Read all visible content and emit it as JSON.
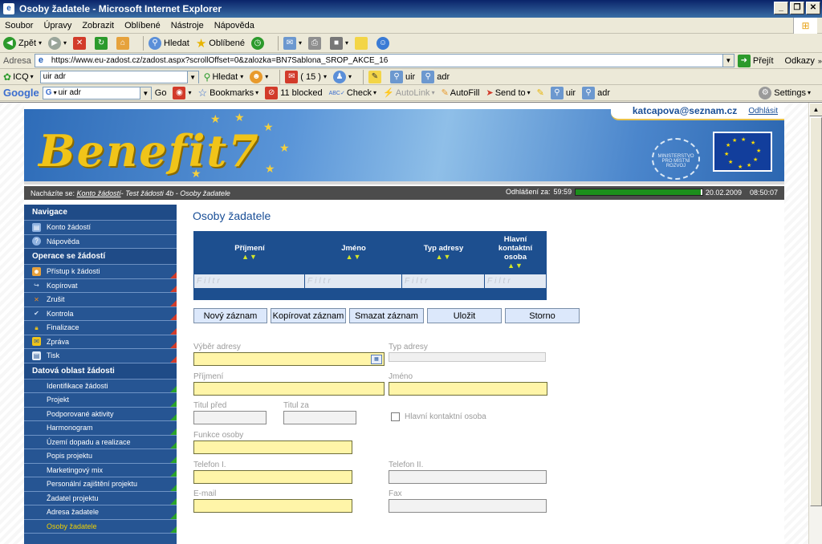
{
  "window": {
    "title": "Osoby žadatele - Microsoft Internet Explorer"
  },
  "menu": [
    "Soubor",
    "Úpravy",
    "Zobrazit",
    "Oblíbené",
    "Nástroje",
    "Nápověda"
  ],
  "toolbar": {
    "back": "Zpět",
    "search": "Hledat",
    "favorites": "Oblíbené"
  },
  "address": {
    "label": "Adresa",
    "url": "https://www.eu-zadost.cz/zadost.aspx?scrollOffset=0&zalozka=BN7Sablona_SROP_AKCE_16",
    "go": "Přejít",
    "links": "Odkazy"
  },
  "icqbar": {
    "icq": "ICQ",
    "query": "uir adr",
    "search": "Hledat",
    "count": "( 15 )",
    "uir": "uir",
    "adr": "adr"
  },
  "googlebar": {
    "brand": "Google",
    "query": "uir adr",
    "go": "Go",
    "bookmarks": "Bookmarks",
    "blocked": "11 blocked",
    "check": "Check",
    "autolink": "AutoLink",
    "autofill": "AutoFill",
    "sendto": "Send to",
    "uir": "uir",
    "adr": "adr",
    "settings": "Settings"
  },
  "header": {
    "logo": "Benefit7",
    "user_email": "katcapova@seznam.cz",
    "logout": "Odhlásit",
    "ministry": "MINISTERSTVO PRO MÍSTNÍ ROZVOJ"
  },
  "breadcrumb": {
    "prefix": "Nacházíte se:",
    "link": "Konto žádostí",
    "rest": " - Test žádosti 4b - Osoby žadatele",
    "logout_in_label": "Odhlášení za:",
    "countdown": "59:59",
    "progress": 0.99,
    "date": "20.02.2009",
    "time": "08:50:07"
  },
  "sidebar": {
    "nav_head": "Navigace",
    "nav_items": [
      "Konto žádostí",
      "Nápověda"
    ],
    "ops_head": "Operace se žádostí",
    "ops_items": [
      "Přístup k žádosti",
      "Kopírovat",
      "Zrušit",
      "Kontrola",
      "Finalizace",
      "Zpráva",
      "Tisk"
    ],
    "data_head": "Datová oblast žádosti",
    "data_items": [
      "Identifikace žádosti",
      "Projekt",
      "Podporované aktivity",
      "Harmonogram",
      "Území dopadu a realizace",
      "Popis projektu",
      "Marketingový mix",
      "Personální zajištění projektu",
      "Žadatel projektu",
      "Adresa žadatele",
      "Osoby žadatele"
    ]
  },
  "content": {
    "title": "Osoby žadatele",
    "grid": {
      "columns": [
        "Příjmení",
        "Jméno",
        "Typ adresy",
        "Hlavní kontaktní osoba"
      ],
      "sort": "▲▼",
      "filter": "Filtr"
    },
    "buttons": [
      "Nový záznam",
      "Kopírovat záznam",
      "Smazat záznam",
      "Uložit",
      "Storno"
    ],
    "form": {
      "address_select": "Výběr adresy",
      "address_type": "Typ adresy",
      "surname": "Příjmení",
      "name": "Jméno",
      "title_before": "Titul před",
      "title_after": "Titul za",
      "main_contact": "Hlavní kontaktní osoba",
      "position": "Funkce osoby",
      "phone1": "Telefon I.",
      "phone2": "Telefon II.",
      "email": "E-mail",
      "fax": "Fax"
    }
  },
  "colors": {
    "accent": "#1a4f97",
    "sidebar": "#265593",
    "required": "#fff5a8",
    "progress": "#1c8f1c"
  }
}
